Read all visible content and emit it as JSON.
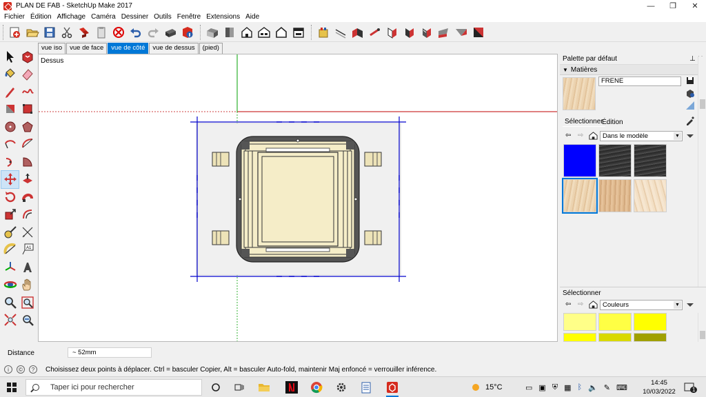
{
  "window": {
    "title": "PLAN DE FAB - SketchUp Make 2017",
    "controls": {
      "minimize": "—",
      "maximize": "❐",
      "close": "✕"
    }
  },
  "menu": [
    "Fichier",
    "Édition",
    "Affichage",
    "Caméra",
    "Dessiner",
    "Outils",
    "Fenêtre",
    "Extensions",
    "Aide"
  ],
  "scene_tabs": [
    {
      "label": "vue iso",
      "active": false
    },
    {
      "label": "vue de face",
      "active": false
    },
    {
      "label": "vue de côté",
      "active": true
    },
    {
      "label": "vue de dessus",
      "active": false
    },
    {
      "label": "(pied)",
      "active": false
    }
  ],
  "viewport": {
    "view_label": "Dessus",
    "colors": {
      "red_axis": "#c00000",
      "green_axis": "#00a000",
      "blue_lines": "#0000cc",
      "panel": "#f0efe4",
      "frame": "#f5edc8",
      "dark": "#555555"
    }
  },
  "palette": {
    "title": "Palette par défaut",
    "pin": "⊥",
    "close": "✕",
    "materials_header": "Matières",
    "material_name": "FRENE",
    "tab_select": "Sélectionner",
    "tab_edit": "Édition",
    "library_dropdown": "Dans le modèle",
    "swatches": [
      {
        "name": "blue",
        "color": "#0000ff"
      },
      {
        "name": "dark-stone-1",
        "color": "#3b3b3b"
      },
      {
        "name": "dark-stone-2",
        "color": "#3b3b3b"
      },
      {
        "name": "frene-light",
        "color": "#ecd3b0",
        "selected": true
      },
      {
        "name": "wood-mid",
        "color": "#dfb98e"
      },
      {
        "name": "wood-pale",
        "color": "#f3e0c6"
      }
    ],
    "second_header": "Sélectionner",
    "colors_dropdown": "Couleurs",
    "color_swatches": [
      "#ffff88",
      "#ffff44",
      "#ffff00",
      "#ffff00",
      "#d9d900",
      "#a0a000"
    ]
  },
  "measure": {
    "label": "Distance",
    "value": "~ 52mm"
  },
  "status": {
    "text": "Choisissez deux points à déplacer.  Ctrl = basculer Copier, Alt = basculer Auto-fold, maintenir Maj enfoncé = verrouiller inférence."
  },
  "taskbar": {
    "search_placeholder": "Taper ici pour rechercher",
    "weather": "15°C",
    "time": "14:45",
    "date": "10/03/2022",
    "notification_count": "1"
  }
}
